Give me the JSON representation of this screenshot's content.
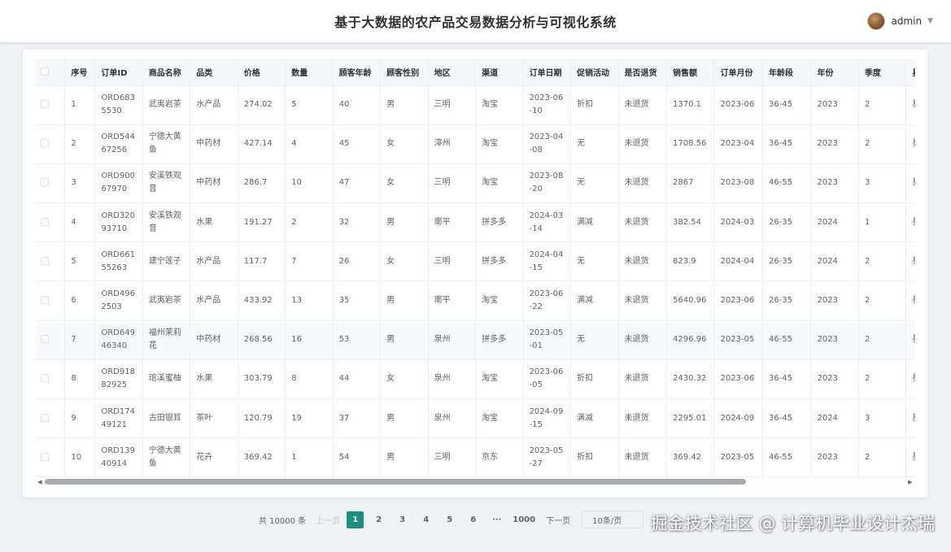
{
  "header": {
    "title": "基于大数据的农产品交易数据分析与可视化系统",
    "username": "admin"
  },
  "table": {
    "columns": [
      "序号",
      "订单ID",
      "商品名称",
      "品类",
      "价格",
      "数量",
      "顾客年龄",
      "顾客性别",
      "地区",
      "渠道",
      "订单日期",
      "促销活动",
      "是否退货",
      "销售额",
      "订单月份",
      "年龄段",
      "年份",
      "季度",
      "星期几"
    ],
    "rows": [
      [
        "1",
        "ORD6835530",
        "武夷岩茶",
        "水产品",
        "274.02",
        "5",
        "40",
        "男",
        "三明",
        "淘宝",
        "2023-06-10",
        "折扣",
        "未退货",
        "1370.1",
        "2023-06",
        "36-45",
        "2023",
        "2",
        "星期六"
      ],
      [
        "2",
        "ORD54467256",
        "宁德大黄鱼",
        "中药材",
        "427.14",
        "4",
        "45",
        "女",
        "漳州",
        "淘宝",
        "2023-04-08",
        "无",
        "未退货",
        "1708.56",
        "2023-04",
        "36-45",
        "2023",
        "2",
        "星期六"
      ],
      [
        "3",
        "ORD90067970",
        "安溪铁观音",
        "中药材",
        "286.7",
        "10",
        "47",
        "女",
        "三明",
        "淘宝",
        "2023-08-20",
        "无",
        "未退货",
        "2867",
        "2023-08",
        "46-55",
        "2023",
        "3",
        "星期日"
      ],
      [
        "4",
        "ORD32093710",
        "安溪铁观音",
        "水果",
        "191.27",
        "2",
        "32",
        "男",
        "南平",
        "拼多多",
        "2024-03-14",
        "满减",
        "未退货",
        "382.54",
        "2024-03",
        "26-35",
        "2024",
        "1",
        "星期四"
      ],
      [
        "5",
        "ORD66155263",
        "建宁莲子",
        "水产品",
        "117.7",
        "7",
        "26",
        "女",
        "三明",
        "拼多多",
        "2024-04-15",
        "无",
        "未退货",
        "823.9",
        "2024-04",
        "26-35",
        "2024",
        "2",
        "星期一"
      ],
      [
        "6",
        "ORD4962503",
        "武夷岩茶",
        "水产品",
        "433.92",
        "13",
        "35",
        "男",
        "南平",
        "淘宝",
        "2023-06-22",
        "满减",
        "未退货",
        "5640.96",
        "2023-06",
        "26-35",
        "2023",
        "2",
        "星期四"
      ],
      [
        "7",
        "ORD64946340",
        "福州茉莉花",
        "中药材",
        "268.56",
        "16",
        "53",
        "男",
        "泉州",
        "拼多多",
        "2023-05-01",
        "无",
        "未退货",
        "4296.96",
        "2023-05",
        "46-55",
        "2023",
        "2",
        "星期一"
      ],
      [
        "8",
        "ORD91882925",
        "琯溪蜜柚",
        "水果",
        "303.79",
        "8",
        "44",
        "女",
        "泉州",
        "淘宝",
        "2023-06-05",
        "折扣",
        "未退货",
        "2430.32",
        "2023-06",
        "36-45",
        "2023",
        "2",
        "星期一"
      ],
      [
        "9",
        "ORD17449121",
        "古田银耳",
        "茶叶",
        "120.79",
        "19",
        "37",
        "男",
        "泉州",
        "淘宝",
        "2024-09-15",
        "满减",
        "未退货",
        "2295.01",
        "2024-09",
        "36-45",
        "2024",
        "3",
        "星期日"
      ],
      [
        "10",
        "ORD13940914",
        "宁德大黄鱼",
        "花卉",
        "369.42",
        "1",
        "54",
        "男",
        "三明",
        "京东",
        "2023-05-27",
        "折扣",
        "未退货",
        "369.42",
        "2023-05",
        "46-55",
        "2023",
        "2",
        "星期六"
      ]
    ]
  },
  "pagination": {
    "total": "共 10000 条",
    "prev": "上一页",
    "pages": [
      "1",
      "2",
      "3",
      "4",
      "5",
      "6",
      "···",
      "1000"
    ],
    "active": "1",
    "next": "下一页",
    "page_size": "10条/页"
  },
  "watermark": "掘金技术社区 @ 计算机毕业设计杰瑞",
  "colors": {
    "accent": "#1e8e7e",
    "header_bg": "#ffffff",
    "page_bg": "#f0f2f5"
  }
}
